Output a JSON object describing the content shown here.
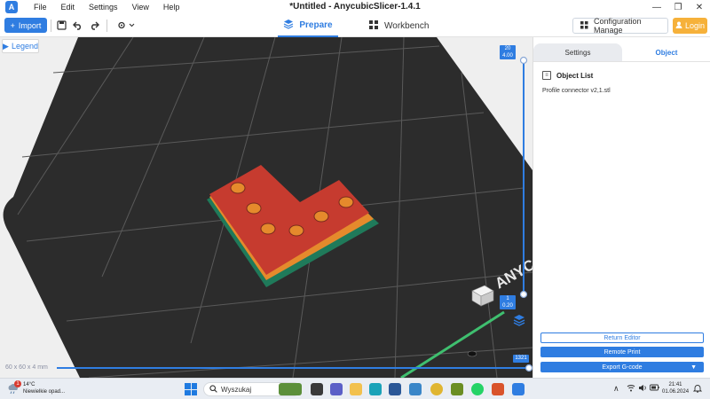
{
  "app": {
    "window_title": "*Untitled - AnycubicSlicer-1.4.1",
    "logo_glyph": "A"
  },
  "menu": [
    "File",
    "Edit",
    "Settings",
    "View",
    "Help"
  ],
  "window_controls": {
    "minimize": "—",
    "maximize": "❐",
    "close": "✕"
  },
  "toolbar": {
    "import_label": "Import",
    "import_glyph": "+",
    "tabs": [
      {
        "label": "Prepare",
        "active": true
      },
      {
        "label": "Workbench",
        "active": false
      }
    ],
    "configuration_label": "Configuration Manage",
    "login_label": "Login"
  },
  "viewport": {
    "legend_label": "Legend",
    "dimensions": "60 x 60 x 4 mm",
    "layer_top": {
      "value": "20",
      "height": "4.00"
    },
    "layer_bottom": {
      "value": "1",
      "height": "0.20"
    },
    "horizontal_slider_value": "1321",
    "bed_brand_text": "ANYC"
  },
  "panel": {
    "tabs": [
      {
        "label": "Settings",
        "active": false
      },
      {
        "label": "Object",
        "active": true
      }
    ],
    "object_list_title": "Object List",
    "objects": [
      "Profile connector v2,1.stl"
    ],
    "return_editor_label": "Return Editor",
    "remote_print_label": "Remote Print",
    "export_label": "Export G-code"
  },
  "taskbar": {
    "weather_temp": "14°C",
    "weather_desc": "Niewielkie opad...",
    "weather_badge": "1",
    "search_placeholder": "Wyszukaj",
    "clock_time": "21:41",
    "clock_date": "01.06.2024"
  },
  "colors": {
    "accent": "#2f7de1",
    "login": "#f6b13a",
    "model_top": "#c63b2f",
    "model_side": "#e58a2c",
    "model_base": "#1f7a5a",
    "bed": "#2c2c2c"
  }
}
